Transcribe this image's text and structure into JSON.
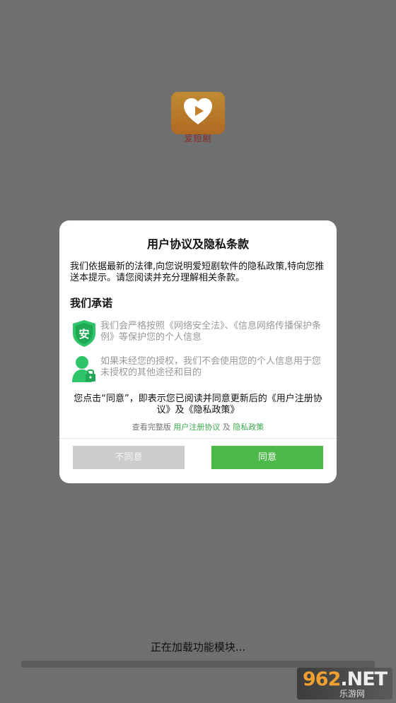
{
  "splash": {
    "app_logo_text": "爱短剧",
    "loading_text": "正在加载功能模块..."
  },
  "watermark": {
    "main_digits": "962",
    "main_suffix": ".NET",
    "sub": "乐游网"
  },
  "dialog": {
    "title": "用户协议及隐私条款",
    "intro": "我们依据最新的法律,向您说明爱短剧软件的隐私政策,特向您推送本提示。请您阅读并充分理解相关条款。",
    "subtitle": "我们承诺",
    "promises": [
      {
        "icon": "shield-an-icon",
        "icon_char": "安",
        "text": "我们会严格按照《网络安全法》、《信息网络传播保护条例》等保护您的个人信息"
      },
      {
        "icon": "user-lock-icon",
        "text": "如果未经您的授权，我们不会使用您的个人信息用于您未授权的其他途径和目的"
      }
    ],
    "consent": "您点击“同意”，即表示您已阅读并同意更新后的《用户注册协议》及《隐私政策》",
    "links": {
      "prefix": "查看完整版",
      "user_agreement": "用户注册协议",
      "and": "及",
      "privacy_policy": "隐私政策"
    },
    "buttons": {
      "disagree": "不同意",
      "agree": "同意"
    }
  },
  "colors": {
    "overlay": "#6f6f6f",
    "accent_green": "#4cba48",
    "link_green": "#3aab4b",
    "disabled_gray": "#cccccc"
  }
}
